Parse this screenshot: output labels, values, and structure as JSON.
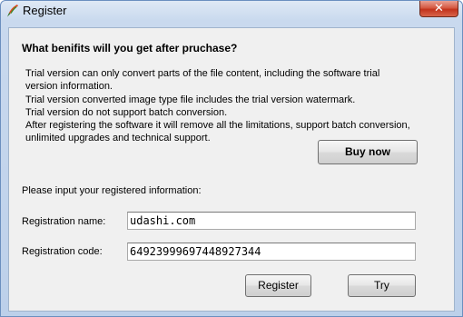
{
  "window": {
    "title": "Register"
  },
  "titlebar": {
    "close_label": "✕",
    "app_icon": "feather-pen-icon"
  },
  "content": {
    "heading": "What benifits will you get after pruchase?",
    "info_lines": [
      "Trial version can only convert parts of the file content, including the software trial",
      "version information.",
      "Trial version converted image type file includes the trial version watermark.",
      "Trial version do not support batch conversion.",
      "After registering the software it will remove all the limitations, support batch conversion,",
      "unlimited upgrades and technical support."
    ],
    "buy_label": "Buy now",
    "prompt": "Please input your registered information:"
  },
  "form": {
    "name_label": "Registration name:",
    "name_value": "udashi.com",
    "code_label": "Registration code:",
    "code_value": "64923999697448927344"
  },
  "actions": {
    "register_label": "Register",
    "try_label": "Try"
  },
  "colors": {
    "close_button": "#c2331c",
    "titlebar": "#c9d9ee",
    "client_background": "#f0f0f0"
  }
}
